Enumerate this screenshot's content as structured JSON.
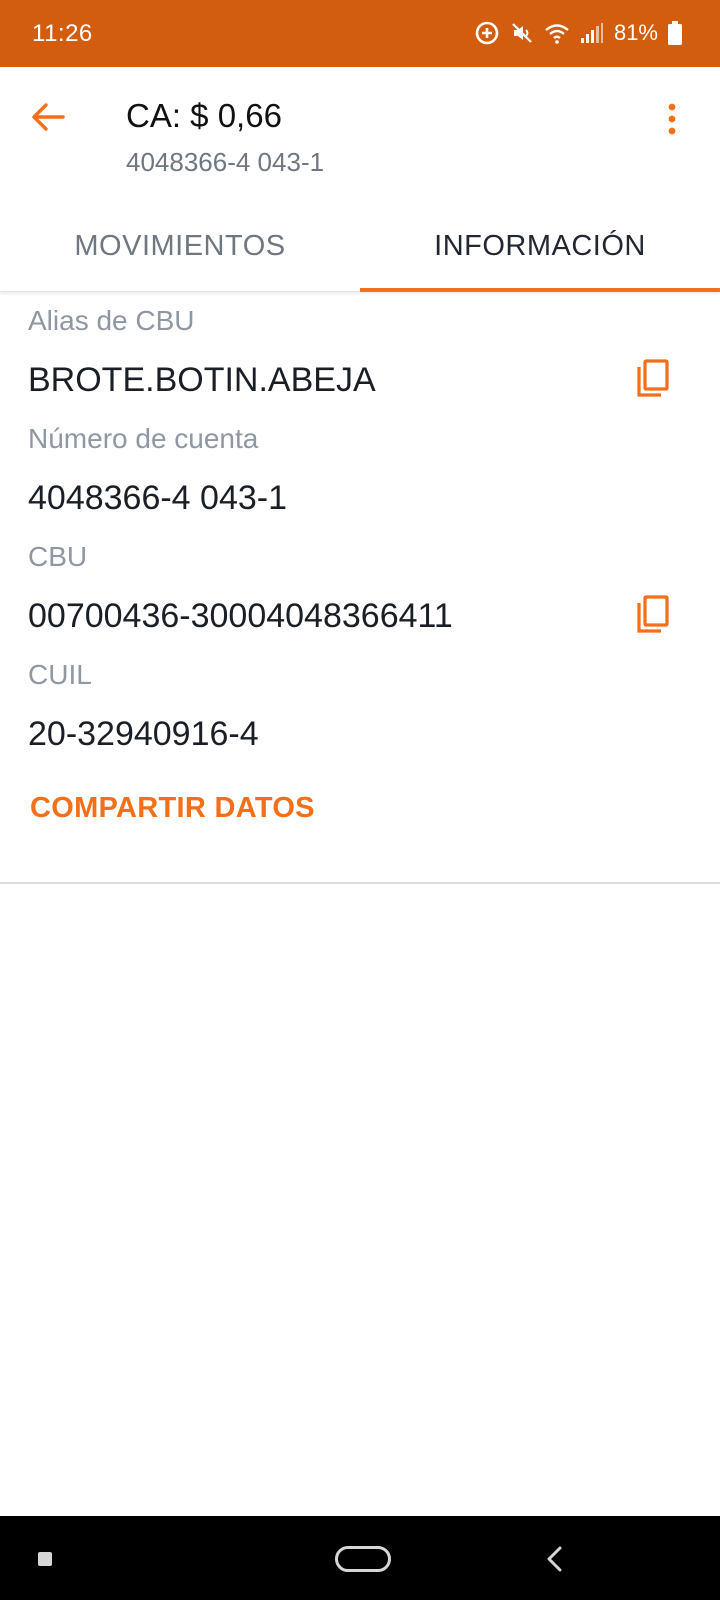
{
  "status_bar": {
    "time": "11:26",
    "battery": "81%",
    "background_color": "#d35d0e",
    "icons": [
      "data-saver-icon",
      "mute-icon",
      "wifi-icon",
      "signal-icon",
      "battery-icon"
    ]
  },
  "app_bar": {
    "title": "CA: $ 0,66",
    "subtitle": "4048366-4 043-1",
    "back_icon": "arrow-back-icon",
    "menu_icon": "more-vert-icon"
  },
  "tabs": [
    {
      "label": "MOVIMIENTOS",
      "active": false
    },
    {
      "label": "INFORMACIÓN",
      "active": true
    }
  ],
  "info": {
    "fields": [
      {
        "label": "Alias de CBU",
        "value": "BROTE.BOTIN.ABEJA",
        "copyable": true
      },
      {
        "label": "Número de cuenta",
        "value": "4048366-4 043-1",
        "copyable": false
      },
      {
        "label": "CBU",
        "value": "00700436-30004048366411",
        "copyable": true
      },
      {
        "label": "CUIL",
        "value": "20-32940916-4",
        "copyable": false
      }
    ],
    "share_label": "COMPARTIR DATOS"
  },
  "colors": {
    "accent": "#f36f19",
    "label_gray": "#8e97a2",
    "text_dark": "#1a1f26"
  },
  "nav_bar": {
    "icons": [
      "recents-icon",
      "home-icon",
      "back-icon"
    ]
  }
}
